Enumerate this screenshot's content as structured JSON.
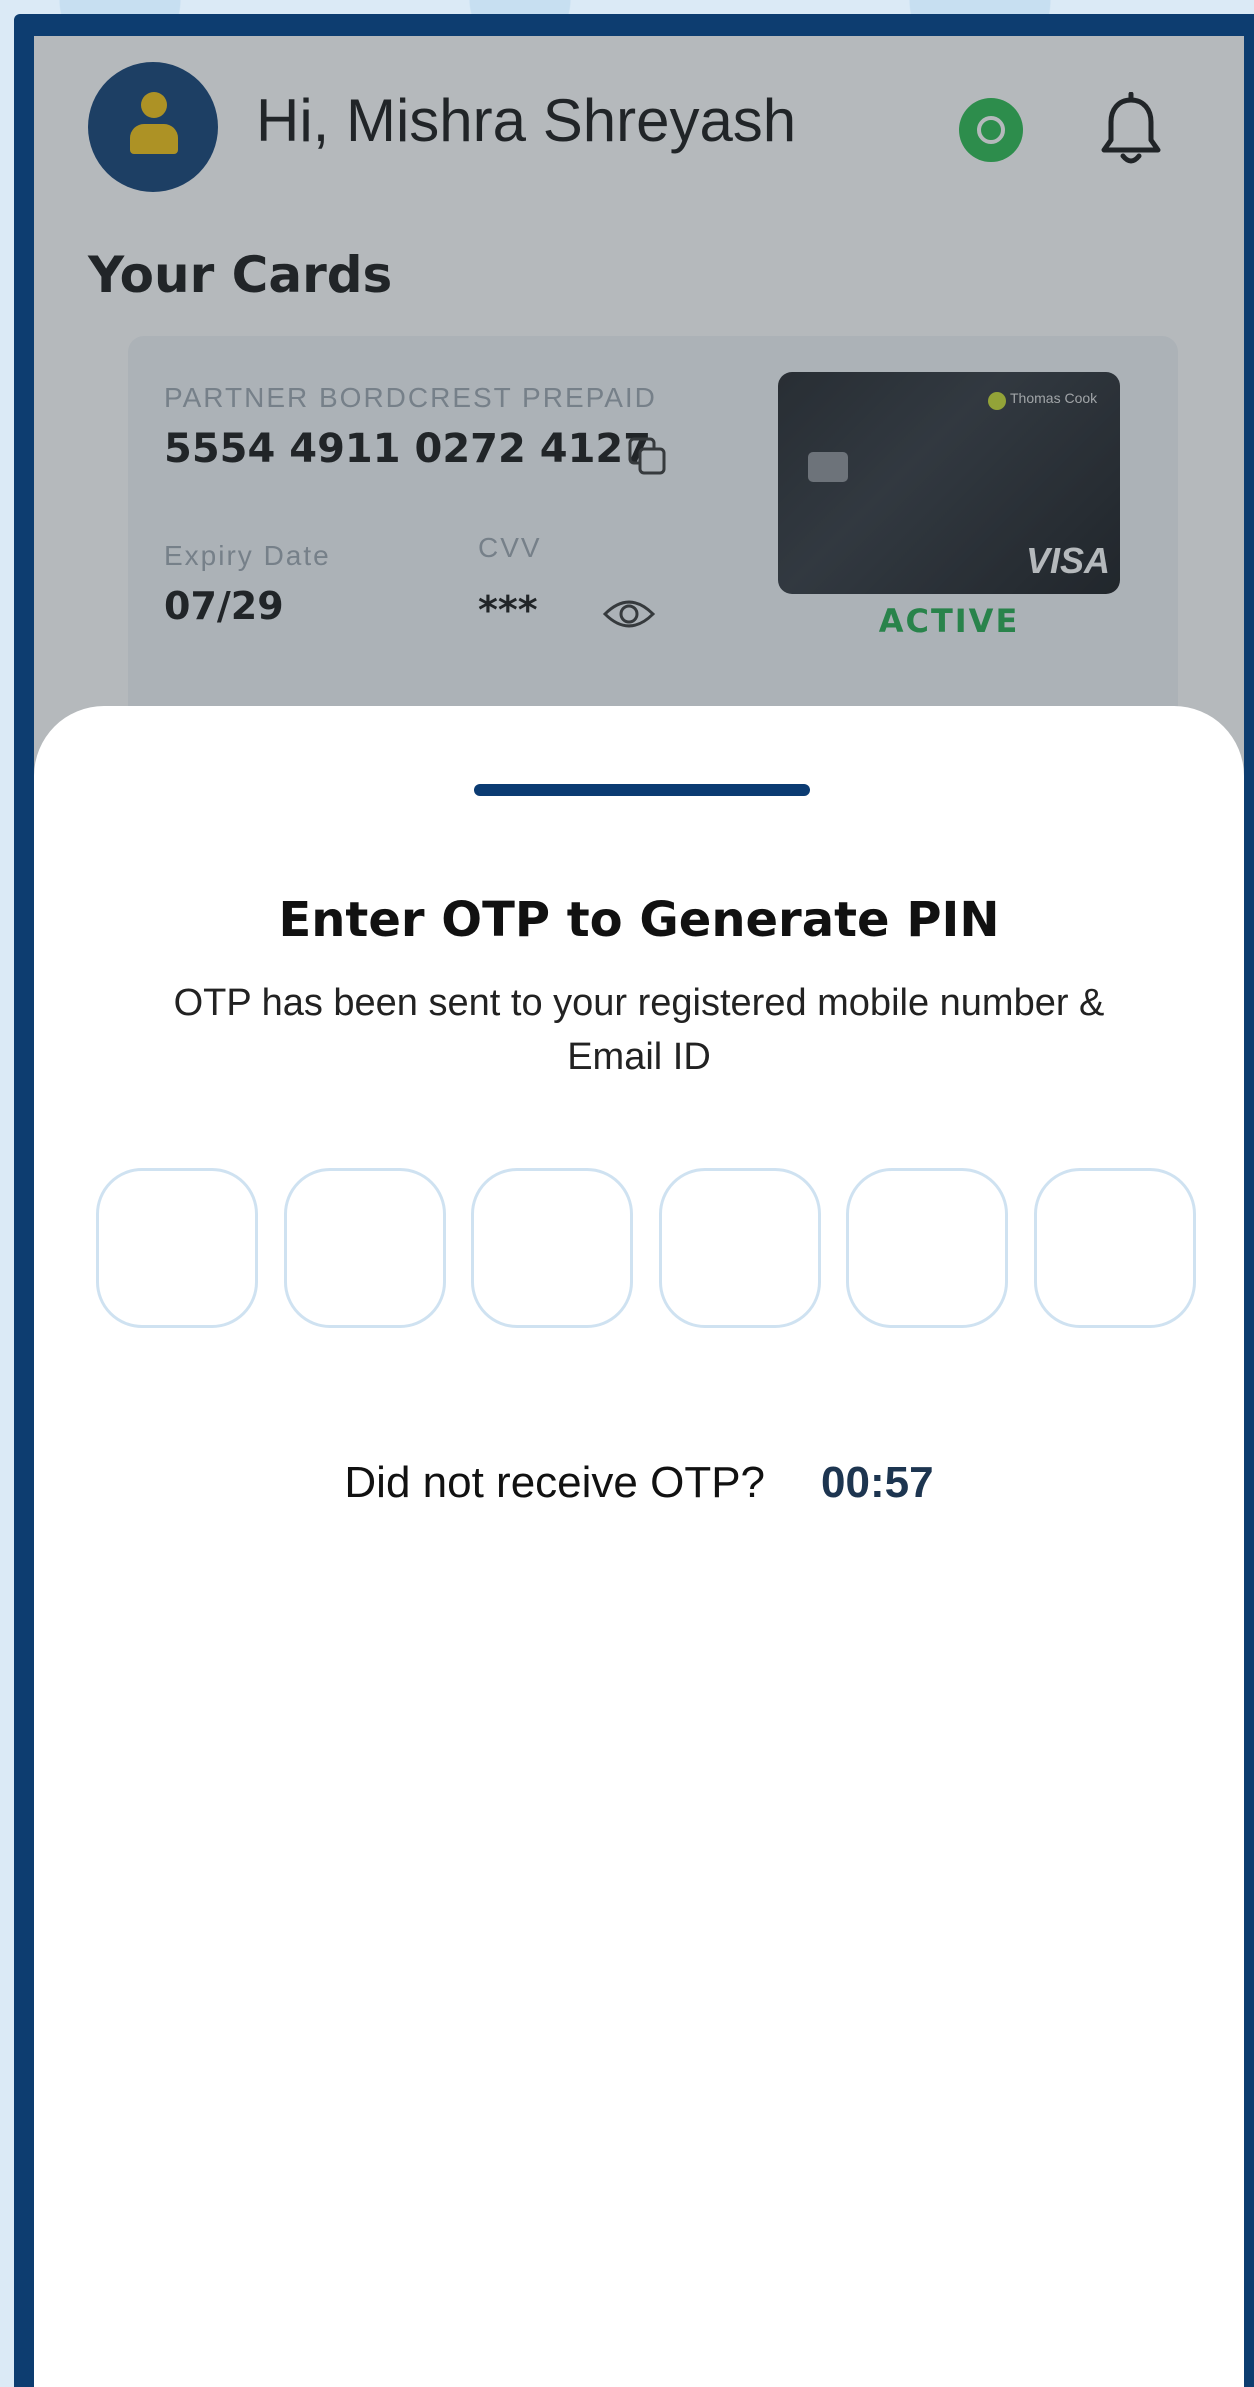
{
  "header": {
    "greeting": "Hi, Mishra Shreyash",
    "avatar_icon": "user-avatar-icon",
    "whatsapp_icon": "whatsapp-icon",
    "notification_icon": "bell-icon"
  },
  "cards_section": {
    "title": "Your Cards",
    "card": {
      "label": "PARTNER BORDCREST PREPAID",
      "number": "5554 4911 0272 4127",
      "expiry_label": "Expiry Date",
      "expiry": "07/29",
      "cvv_label": "CVV",
      "cvv": "***",
      "brand": "Thomas Cook",
      "network": "VISA",
      "status": "ACTIVE"
    }
  },
  "otp_sheet": {
    "title": "Enter OTP to Generate PIN",
    "subtitle": "OTP has been sent to your registered mobile number & Email ID",
    "digits": [
      "",
      "",
      "",
      "",
      "",
      ""
    ],
    "resend_label": "Did not receive OTP?",
    "timer": "00:57"
  },
  "colors": {
    "frame": "#0d3d70",
    "accent": "#0b3b72",
    "status_active": "#1ea84a",
    "otp_border": "#cfe2f1"
  }
}
